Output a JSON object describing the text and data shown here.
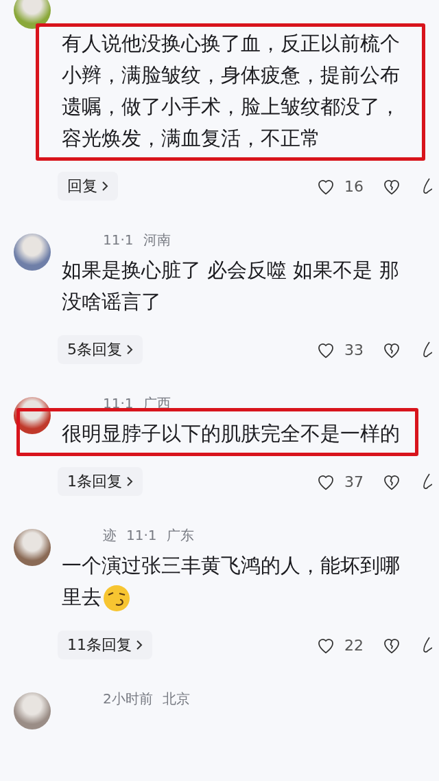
{
  "comments": [
    {
      "text": "有人说他没换心换了血，反正以前梳个小辫，满脸皱纹，身体疲惫，提前公布遗嘱，做了小手术，脸上皱纹都没了，容光焕发，满血复活，不正常",
      "highlighted": true,
      "emoji": false,
      "replies": "回复",
      "likes": "16"
    },
    {
      "meta": [
        "11·1",
        "河南"
      ],
      "text": "如果是换心脏了 必会反噬 如果不是 那没啥谣言了",
      "highlighted": false,
      "emoji": false,
      "replies": "5条回复",
      "likes": "33"
    },
    {
      "meta": [
        "11·1",
        "广西"
      ],
      "text": "很明显脖子以下的肌肤完全不是一样的",
      "highlighted": true,
      "emoji": false,
      "replies": "1条回复",
      "likes": "37"
    },
    {
      "meta": [
        "迹",
        "11·1",
        "广东"
      ],
      "text": "一个演过张三丰黄飞鸿的人，能坏到哪里去",
      "highlighted": false,
      "emoji": true,
      "replies": "11条回复",
      "likes": "22"
    },
    {
      "meta": [
        "2小时前",
        "北京"
      ]
    }
  ]
}
